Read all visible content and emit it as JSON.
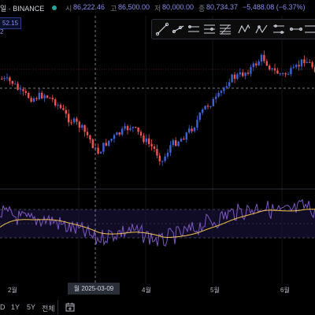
{
  "info_bar": {
    "symbol_suffix": "일 · BINANCE",
    "open_label": "시",
    "open_value": "86,222.46",
    "high_label": "고",
    "high_value": "86,500.00",
    "low_label": "저",
    "low_value": "80,000.00",
    "close_label": "종",
    "close_value": "80,734.37",
    "change": "−5,488.08 (−6.37%)"
  },
  "price_box": {
    "value": "52.15",
    "sub": "2"
  },
  "toolbar": {
    "icons": [
      "trend-line-icon",
      "ray-icon",
      "parallel-channel-icon",
      "horizontal-lines-icon",
      "fib-icon",
      "zigzag-pattern-icon",
      "triangle-pattern-icon",
      "head-shoulders-icon",
      "range-icon",
      "long-position-icon"
    ]
  },
  "x_axis": {
    "labels": [
      "2월",
      "4월",
      "5월",
      "6월"
    ],
    "crosshair_label": "월 2025-03-09"
  },
  "bottom_bar": {
    "range_d": "D",
    "range_1y": "1Y",
    "range_5y": "5Y",
    "range_all": "전체"
  },
  "colors": {
    "bull": "#3d62d8",
    "bear": "#ef5350",
    "rsi_line": "#7e57c2",
    "rsi_ma": "#f0c14b",
    "background": "#000000"
  },
  "chart_data": {
    "type": "candlestick",
    "title": "",
    "description_series": [
      {
        "name": "price"
      },
      {
        "name": "RSI"
      },
      {
        "name": "RSI MA"
      }
    ]
  }
}
